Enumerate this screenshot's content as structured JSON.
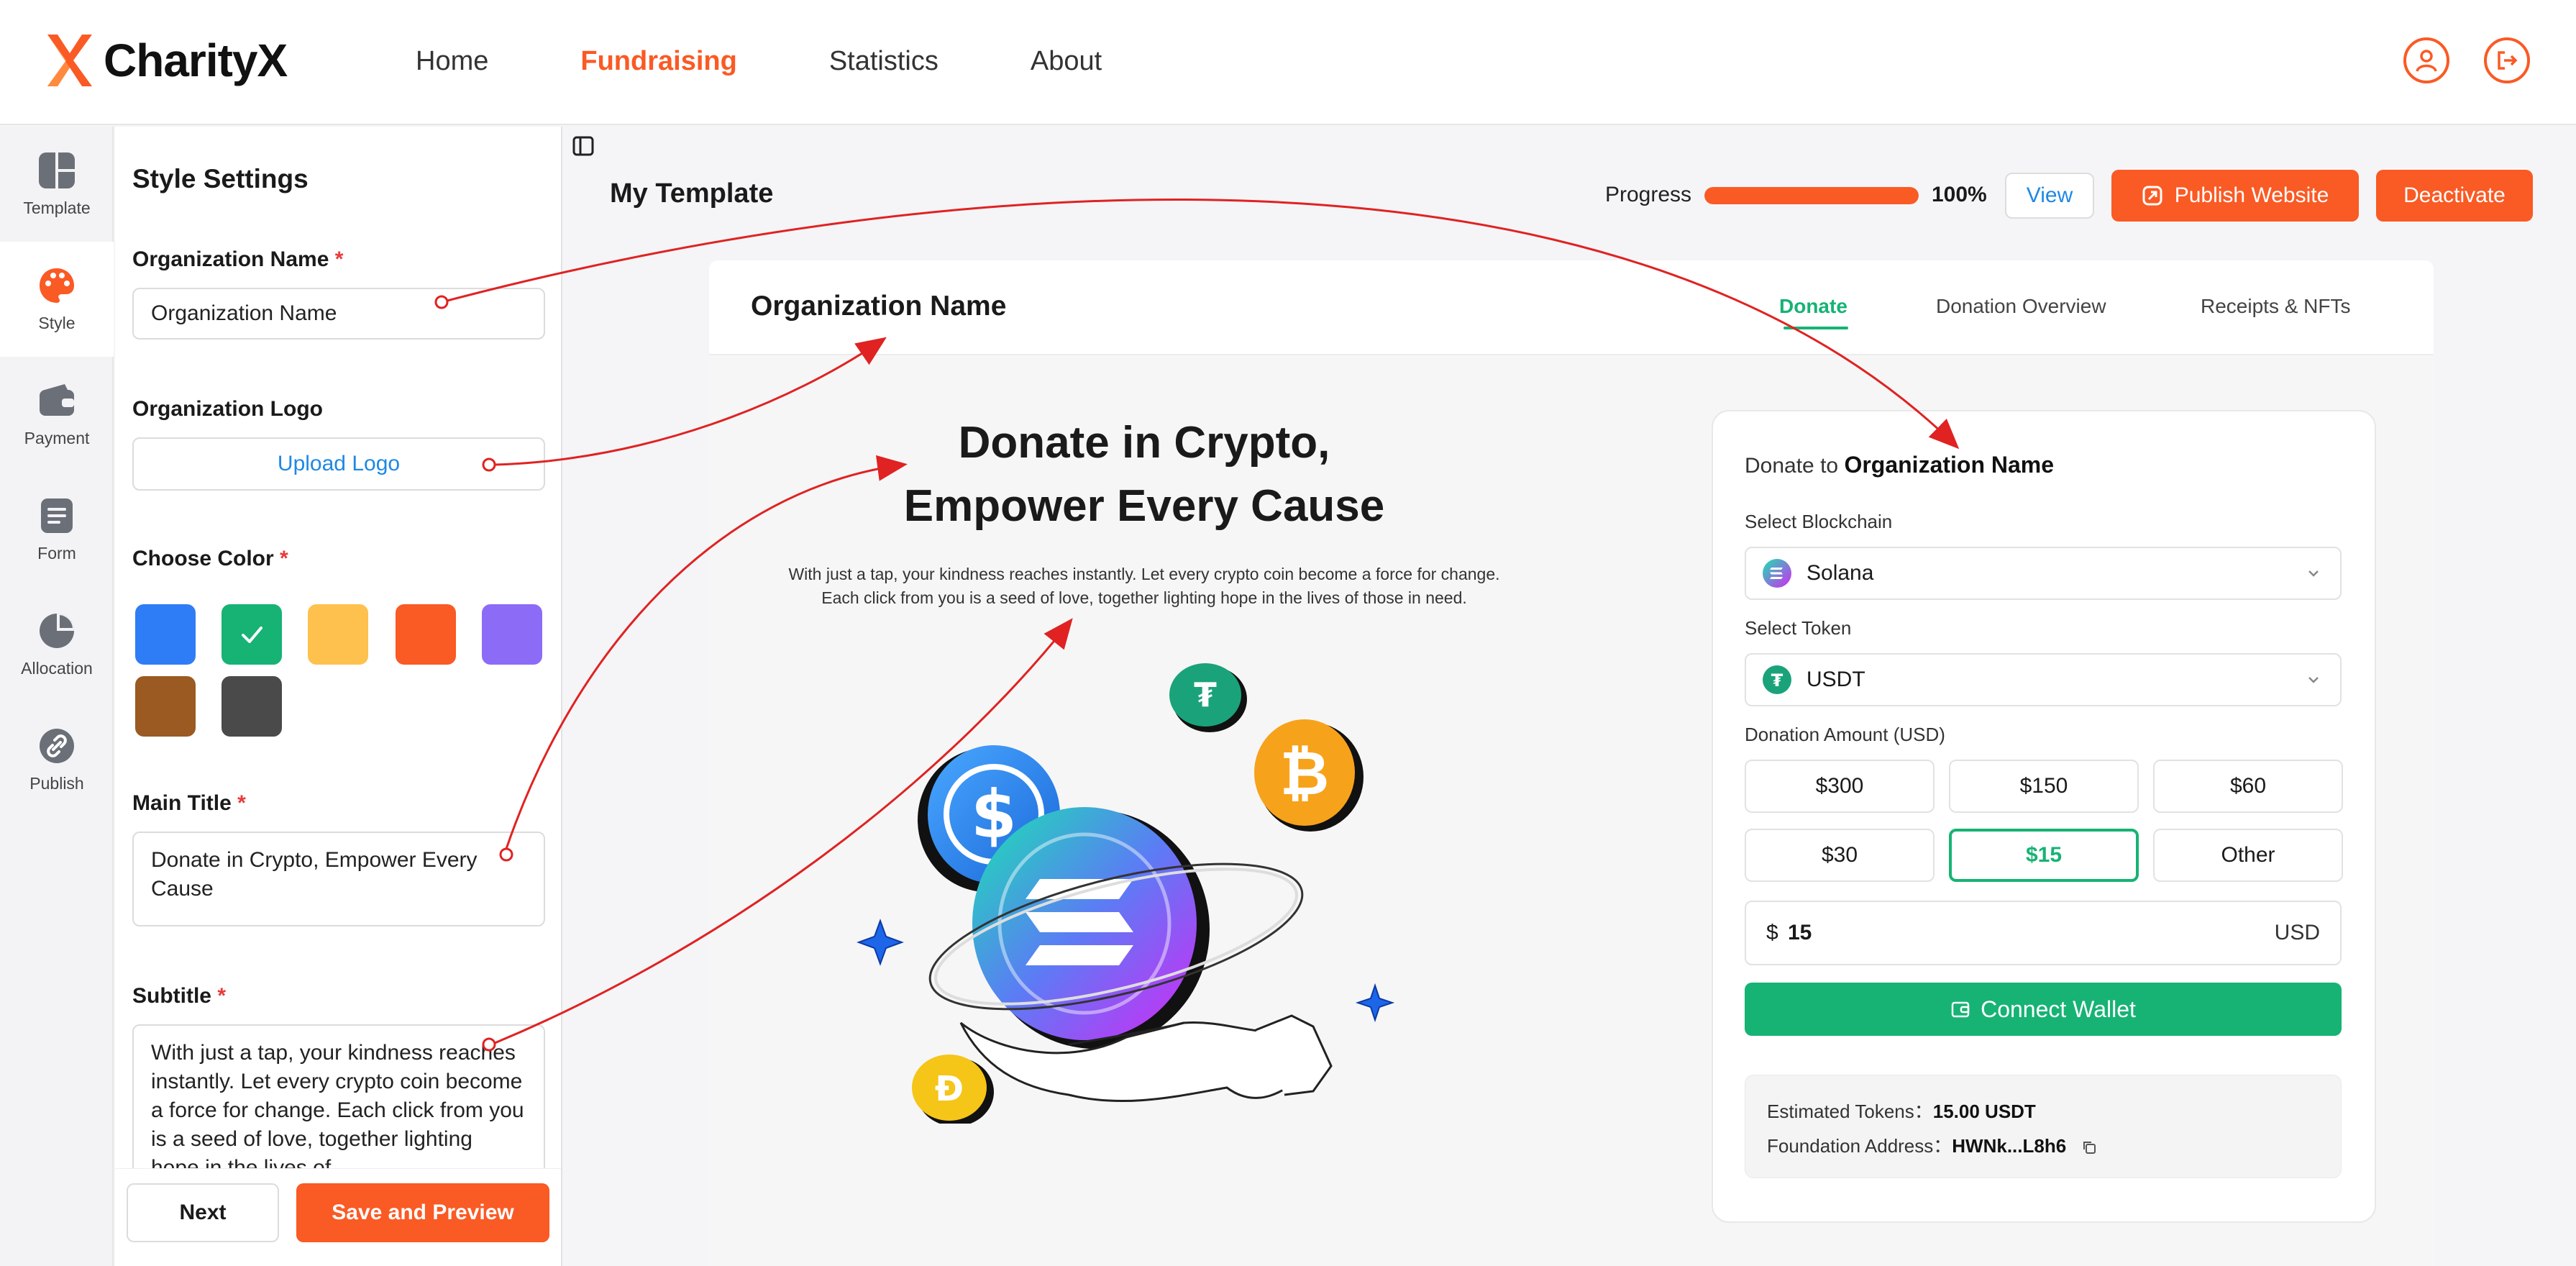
{
  "brand": {
    "name": "CharityX",
    "accent": "#fa5a24"
  },
  "nav": {
    "links": [
      "Home",
      "Fundraising",
      "Statistics",
      "About"
    ],
    "active": "Fundraising",
    "icons": [
      "user-icon",
      "logout-icon"
    ]
  },
  "rail": {
    "items": [
      {
        "label": "Template",
        "icon": "template-icon"
      },
      {
        "label": "Style",
        "icon": "palette-icon",
        "active": true
      },
      {
        "label": "Payment",
        "icon": "wallet-icon"
      },
      {
        "label": "Form",
        "icon": "form-icon"
      },
      {
        "label": "Allocation",
        "icon": "pie-chart-icon"
      },
      {
        "label": "Publish",
        "icon": "link-icon"
      }
    ]
  },
  "settings": {
    "title": "Style Settings",
    "org_name_label": "Organization Name",
    "org_name_value": "Organization Name",
    "logo_label": "Organization Logo",
    "upload_label": "Upload Logo",
    "color_label": "Choose Color",
    "colors": [
      "#2f7df6",
      "#16b374",
      "#ffc14d",
      "#fa5a24",
      "#8c6cf6",
      "#9a5a22",
      "#4a4a4a"
    ],
    "selected_color": "#16b374",
    "main_title_label": "Main Title",
    "main_title_value": "Donate in Crypto, Empower Every Cause",
    "subtitle_label": "Subtitle",
    "subtitle_value": "With just a tap, your kindness reaches instantly. Let every crypto coin become a force for change. Each click from you is a seed of love, together lighting hope in the lives of",
    "required_mark": "*",
    "next_label": "Next",
    "save_label": "Save and Preview"
  },
  "preview": {
    "title": "My Template",
    "progress_label": "Progress",
    "progress_value": 1.0,
    "progress_text": "100%",
    "view_label": "View",
    "publish_label": "Publish Website",
    "deactivate_label": "Deactivate"
  },
  "site": {
    "org_name": "Organization Name",
    "tabs": [
      "Donate",
      "Donation Overview",
      "Receipts & NFTs"
    ],
    "active_tab": "Donate",
    "hero_title_line1": "Donate in Crypto,",
    "hero_title_line2": "Empower Every Cause",
    "hero_sub_line1": "With just a tap, your kindness reaches instantly. Let every crypto coin become a force for change.",
    "hero_sub_line2": "Each click from you is a seed of love, together lighting hope in the lives of those in need.",
    "card": {
      "head_prefix": "Donate to",
      "head_org": "Organization Name",
      "chain_label": "Select Blockchain",
      "chain_value": "Solana",
      "token_label": "Select Token",
      "token_value": "USDT",
      "amount_label": "Donation Amount (USD)",
      "amounts": [
        "$300",
        "$150",
        "$60",
        "$30",
        "$15",
        "Other"
      ],
      "selected_amount": "$15",
      "currency_symbol": "$",
      "amount_value": "15",
      "currency_unit": "USD",
      "connect_label": "Connect Wallet",
      "est_tokens_label": "Estimated Tokens：",
      "est_tokens_value": "15.00 USDT",
      "foundation_label": "Foundation Address：",
      "foundation_value": "HWNk...L8h6"
    }
  }
}
